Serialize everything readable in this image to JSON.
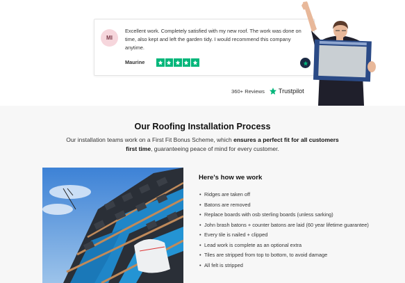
{
  "review": {
    "initials": "MI",
    "text": "Excellent work. Completely satisfied with my new roof. The work was done on time, also kept and left the garden tidy. I would recommend this company anytime.",
    "author": "Maurine",
    "rating": 5
  },
  "trustpilot": {
    "reviews_count": "360+ Reviews",
    "logo_text": "Trustpilot"
  },
  "process": {
    "title": "Our Roofing Installation Process",
    "subtitle_part1": "Our installation teams work on a First Fit Bonus Scheme, which ",
    "subtitle_bold": "ensures a perfect fit for all customers first time",
    "subtitle_part2": ", guaranteeing peace of mind for every customer.",
    "how_title": "Here's how we work",
    "steps": [
      "Ridges are taken off",
      "Batons are removed",
      "Replace boards with osb sterling boards (unless sarking)",
      "John brash batons + counter batons are laid (60 year lifetime guarantee)",
      "Every tile is nailed + clipped",
      "Lead work is complete as an optional extra",
      "Tiles are stripped from top to bottom, to avoid damage",
      "All felt is stripped"
    ]
  },
  "colors": {
    "trustpilot_green": "#00b67a",
    "section_bg": "#f7f7f7",
    "avatar_bg": "#f6d6dc"
  }
}
